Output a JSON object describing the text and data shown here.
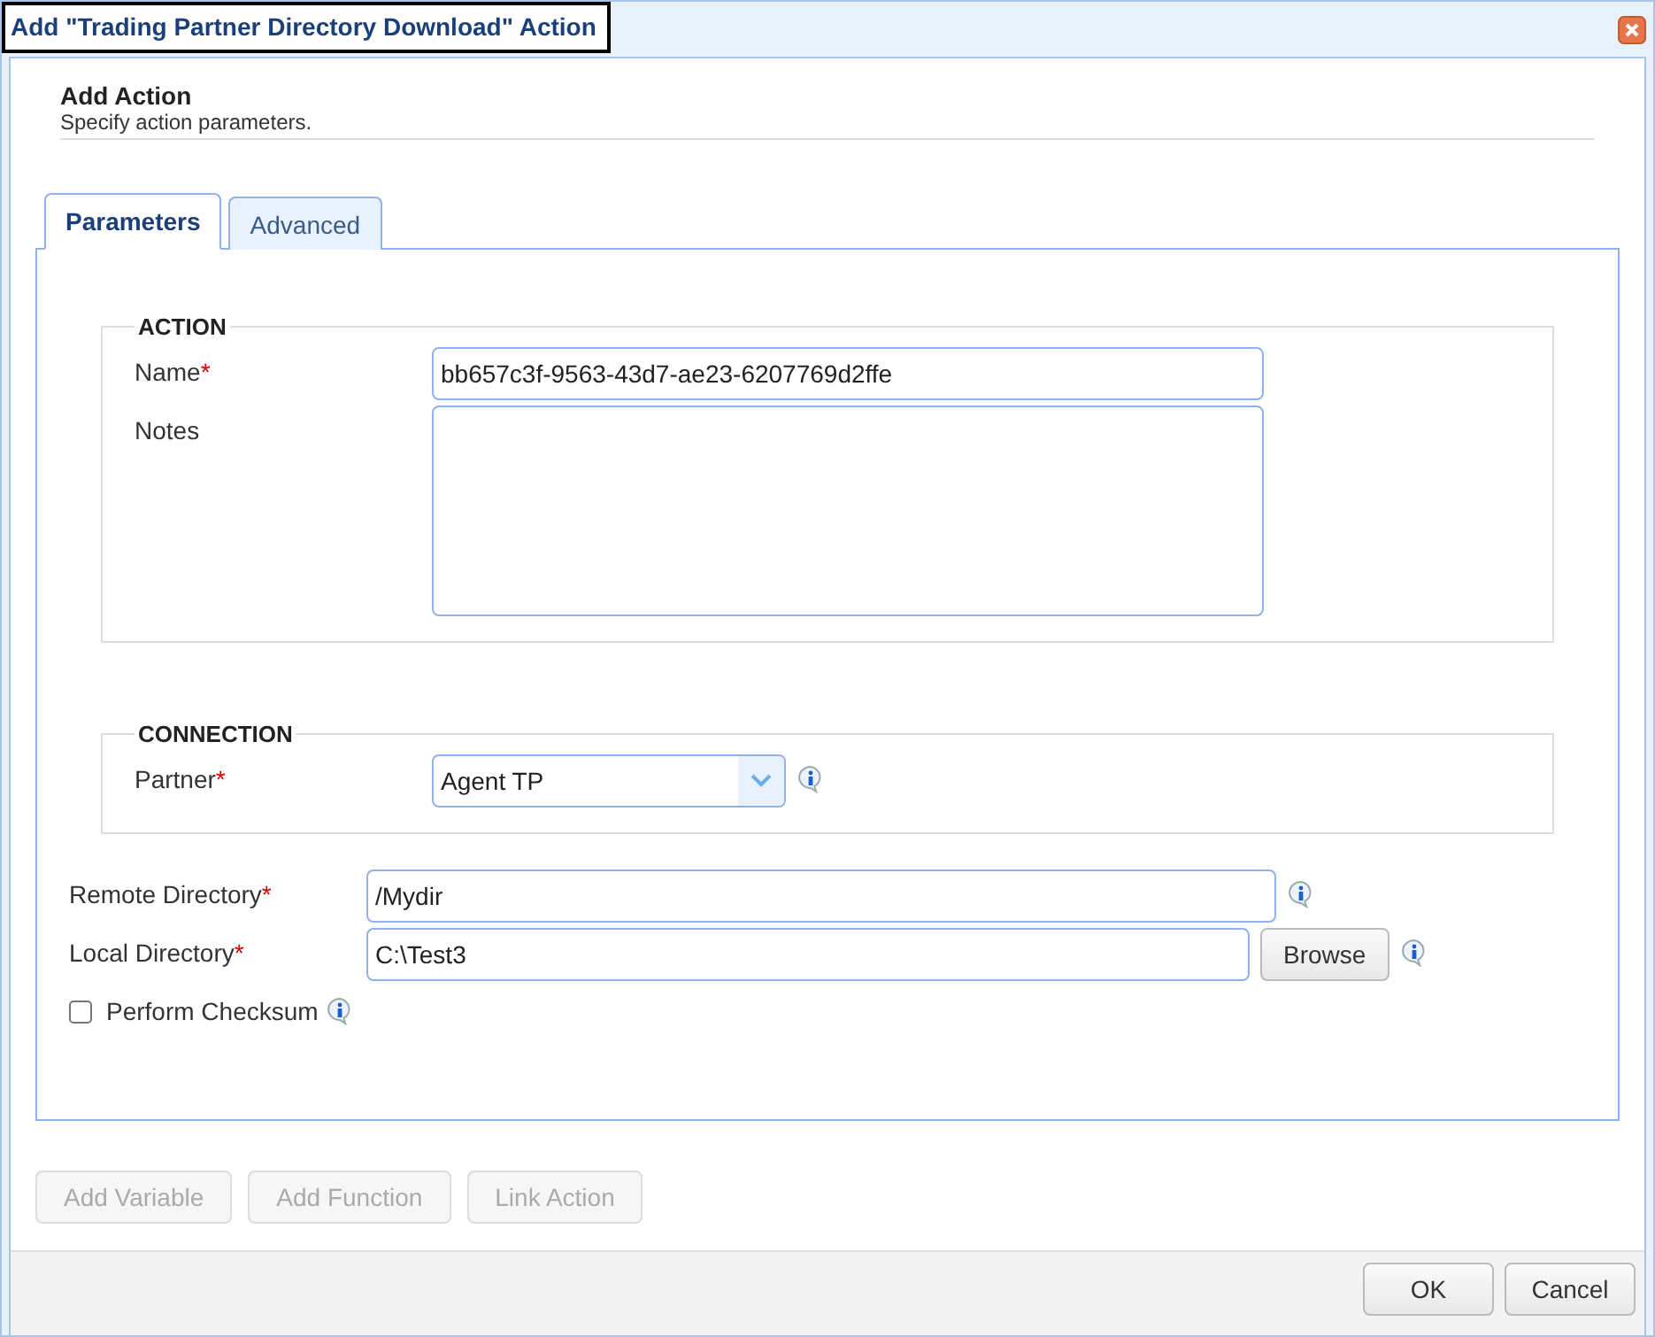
{
  "window": {
    "title": "Add \"Trading Partner Directory Download\" Action"
  },
  "header": {
    "title": "Add Action",
    "subtitle": "Specify action parameters."
  },
  "tabs": [
    {
      "label": "Parameters",
      "selected": true
    },
    {
      "label": "Advanced",
      "selected": false
    }
  ],
  "sections": [
    {
      "legend": "ACTION",
      "fields": [
        {
          "kind": "text",
          "label": "Name",
          "required_mark": "*",
          "value": "bb657c3f-9563-43d7-ae23-6207769d2ffe",
          "info": false
        },
        {
          "kind": "textarea",
          "label": "Notes",
          "info": false
        }
      ]
    },
    {
      "legend": "CONNECTION",
      "fields": [
        {
          "kind": "select",
          "label": "Partner",
          "required_mark": "*",
          "value": "Agent TP",
          "info": true
        }
      ]
    }
  ],
  "fields": [
    {
      "kind": "text",
      "label": "Remote Directory",
      "required_mark": "*",
      "value": "/Mydir",
      "info": true
    },
    {
      "kind": "browse",
      "label": "Local Directory",
      "required_mark": "*",
      "value": "C:\\Test3",
      "button": "Browse",
      "info": true
    }
  ],
  "checkbox": {
    "label": "Perform Checksum",
    "checked": false,
    "info": true
  },
  "tools": [
    {
      "label": "Add Variable",
      "disabled": true
    },
    {
      "label": "Add Function",
      "disabled": true
    },
    {
      "label": "Link Action",
      "disabled": true
    }
  ],
  "footer": [
    {
      "label": "OK"
    },
    {
      "label": "Cancel"
    }
  ]
}
